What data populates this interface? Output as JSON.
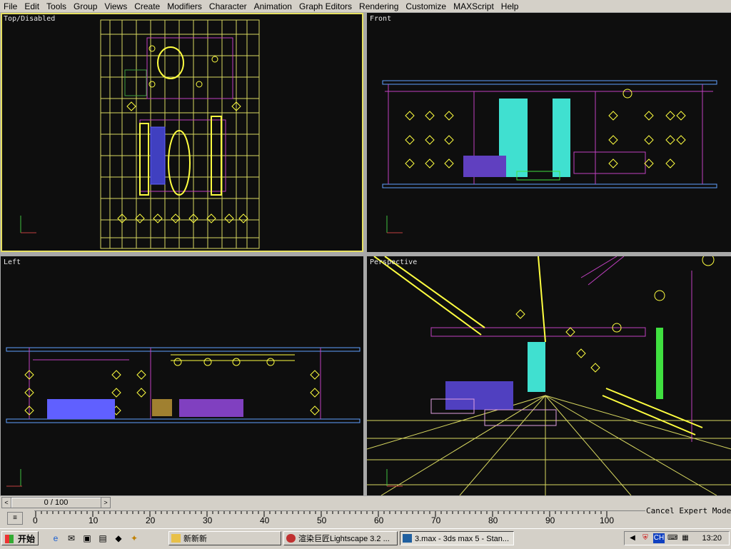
{
  "menu": [
    "File",
    "Edit",
    "Tools",
    "Group",
    "Views",
    "Create",
    "Modifiers",
    "Character",
    "Animation",
    "Graph Editors",
    "Rendering",
    "Customize",
    "MAXScript",
    "Help"
  ],
  "viewports": {
    "top": "Top/Disabled",
    "front": "Front",
    "left": "Left",
    "perspective": "Perspective"
  },
  "time_slider": {
    "value": "0 / 100",
    "prev": "<",
    "next": ">"
  },
  "ticks": [
    "0",
    "10",
    "20",
    "30",
    "40",
    "50",
    "60",
    "70",
    "80",
    "90",
    "100"
  ],
  "prompt": "Cancel Expert Mode",
  "taskbar": {
    "start": "开始",
    "tasks": [
      "新新新",
      "渲染巨匠Lightscape 3.2 ...",
      "3.max - 3ds max 5 - Stan..."
    ],
    "tray_lang": "CH",
    "clock": "13:20"
  },
  "colors": {
    "viewport_bg": "#0e0e0e",
    "active_border": "#e6e060",
    "grid": "#d8d860"
  }
}
